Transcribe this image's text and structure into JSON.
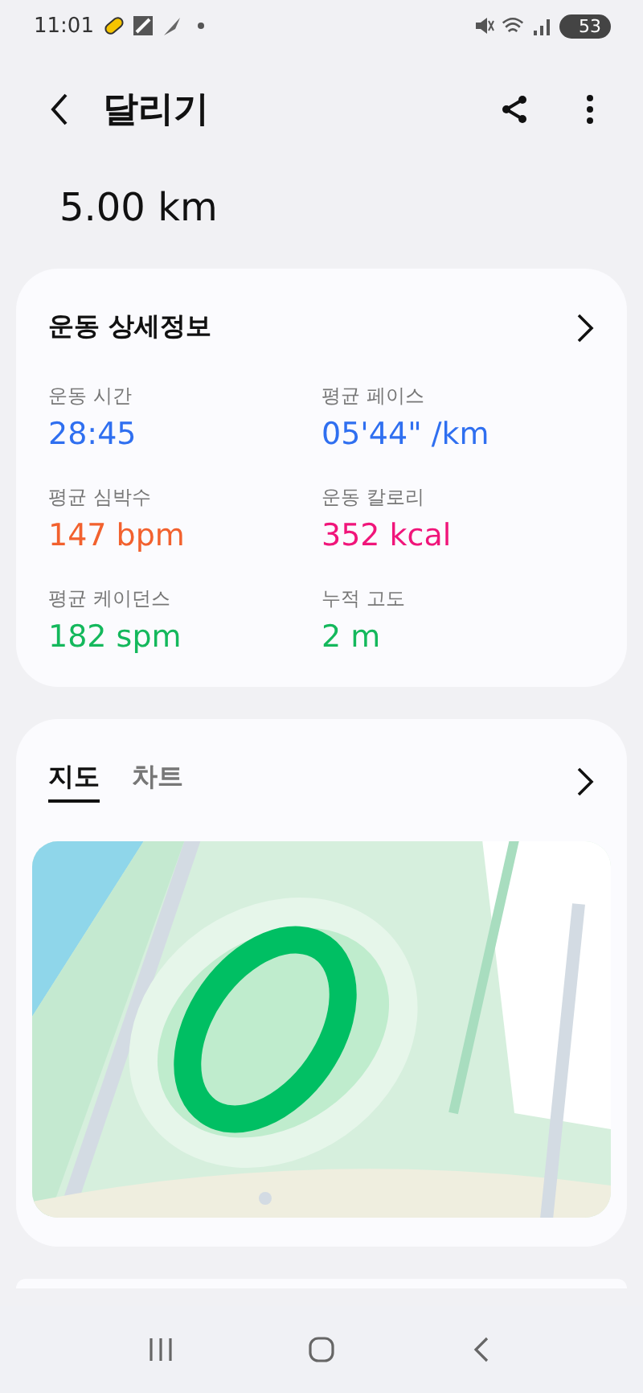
{
  "status_bar": {
    "time": "11:01",
    "battery": "53"
  },
  "header": {
    "title": "달리기"
  },
  "distance": "5.00 km",
  "details": {
    "title": "운동 상세정보",
    "metrics": [
      {
        "label": "운동 시간",
        "value": "28:45",
        "color": "#2f6ff0"
      },
      {
        "label": "평균 페이스",
        "value": "05'44\" /km",
        "color": "#2f6ff0"
      },
      {
        "label": "평균 심박수",
        "value": "147 bpm",
        "color": "#f2612e"
      },
      {
        "label": "운동 칼로리",
        "value": "352 kcal",
        "color": "#f0157a"
      },
      {
        "label": "평균 케이던스",
        "value": "182 spm",
        "color": "#14b85c"
      },
      {
        "label": "누적 고도",
        "value": "2 m",
        "color": "#14b85c"
      }
    ]
  },
  "map_card": {
    "tabs": [
      {
        "label": "지도",
        "selected": true
      },
      {
        "label": "차트",
        "selected": false
      }
    ]
  }
}
